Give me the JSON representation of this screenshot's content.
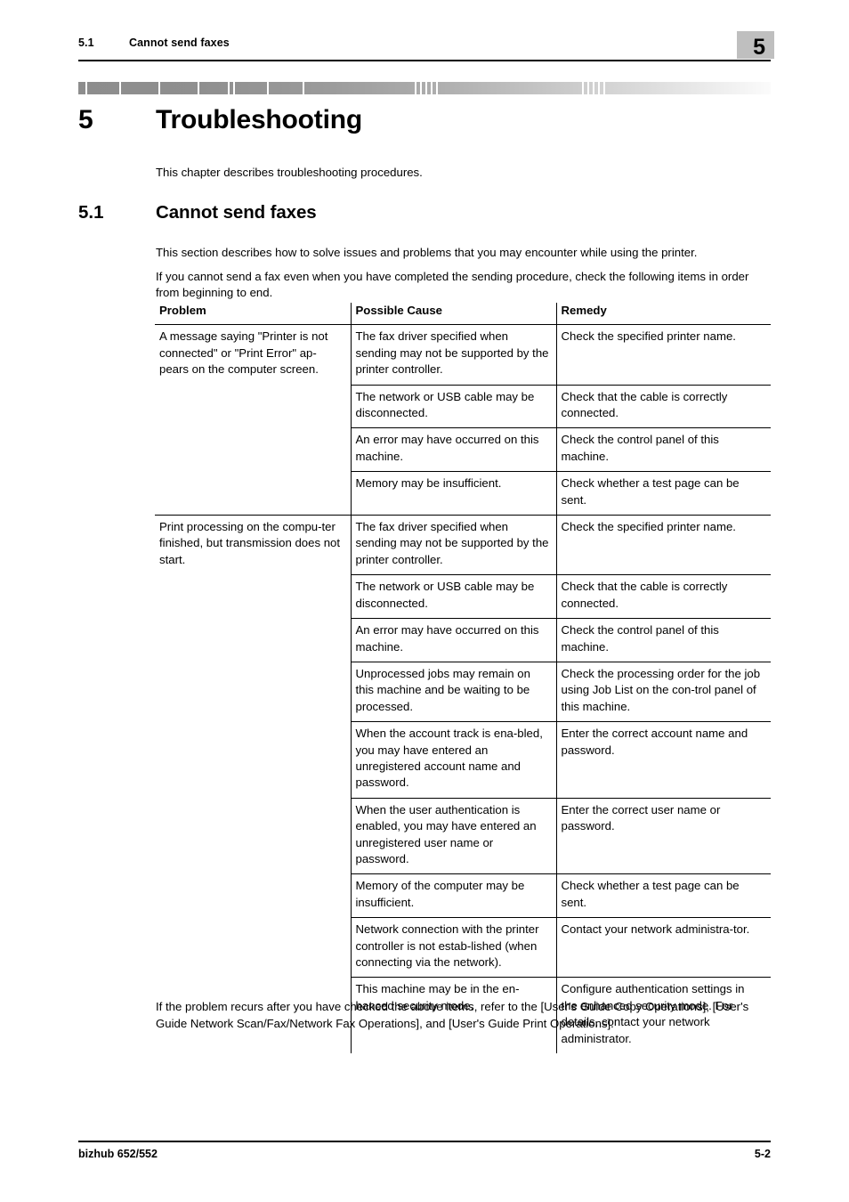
{
  "header": {
    "section_number": "5.1",
    "section_title": "Cannot send faxes",
    "chapter_badge": "5"
  },
  "chapter": {
    "number": "5",
    "title": "Troubleshooting",
    "intro": "This chapter describes troubleshooting procedures."
  },
  "section": {
    "number": "5.1",
    "title": "Cannot send faxes",
    "para_a": "This section describes how to solve issues and problems that you may encounter while using the printer.",
    "para_b": "If you cannot send a fax even when you have completed the sending procedure, check the following items in order from beginning to end."
  },
  "table": {
    "columns": [
      "Problem",
      "Possible Cause",
      "Remedy"
    ],
    "groups": [
      {
        "problem": "A message saying \"Printer is not connected\" or \"Print Error\" ap-pears on the computer screen.",
        "rows": [
          {
            "cause": "The fax driver specified when sending may not be supported by the printer controller.",
            "remedy": "Check the specified printer name."
          },
          {
            "cause": "The network or USB cable may be disconnected.",
            "remedy": "Check that the cable is correctly connected."
          },
          {
            "cause": "An error may have occurred on this machine.",
            "remedy": "Check the control panel of this machine."
          },
          {
            "cause": "Memory may be insufficient.",
            "remedy": "Check whether a test page can be sent."
          }
        ]
      },
      {
        "problem": "Print processing on the compu-ter finished, but transmission does not start.",
        "rows": [
          {
            "cause": "The fax driver specified when sending may not be supported by the printer controller.",
            "remedy": "Check the specified printer name."
          },
          {
            "cause": "The network or USB cable may be disconnected.",
            "remedy": "Check that the cable is correctly connected."
          },
          {
            "cause": "An error may have occurred on this machine.",
            "remedy": "Check the control panel of this machine."
          },
          {
            "cause": "Unprocessed jobs may remain on this machine and be waiting to be processed.",
            "remedy": "Check the processing order for the job using Job List on the con-trol panel of this machine."
          },
          {
            "cause": "When the account track is ena-bled, you may have entered an unregistered account name and password.",
            "remedy": "Enter the correct account name and password."
          },
          {
            "cause": "When the user authentication is enabled, you may have entered an unregistered user name or password.",
            "remedy": "Enter the correct user name or password."
          },
          {
            "cause": "Memory of the computer may be insufficient.",
            "remedy": "Check whether a test page can be sent."
          },
          {
            "cause": "Network connection with the printer controller is not estab-lished (when connecting via the network).",
            "remedy": "Contact your network administra-tor."
          },
          {
            "cause": "This machine may be in the en-hanced security mode.",
            "remedy": "Configure authentication settings in the enhanced security mode. For details, contact your network administrator."
          }
        ]
      }
    ]
  },
  "closing": {
    "text": "If the problem recurs after you have checked the above items, refer to the [User's Guide Copy Operations], [User's Guide Network Scan/Fax/Network Fax Operations], and [User's Guide Print Operations]."
  },
  "footer": {
    "product": "bizhub 652/552",
    "page_number": "5-2"
  },
  "colors": {
    "chapter_badge_bg": "#bfbfbf",
    "rule": "#000000",
    "deco_bar_dark": "#8d8d8d",
    "deco_bar_light": "#fbfbfb"
  }
}
